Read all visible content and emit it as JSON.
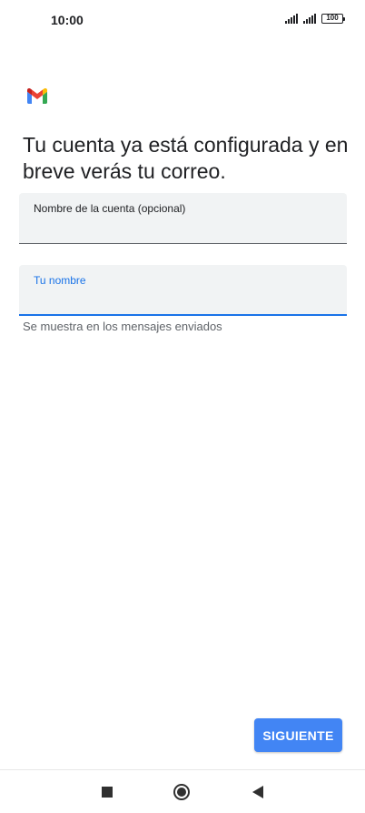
{
  "status_bar": {
    "time": "10:00",
    "battery": "100",
    "icons": [
      "signal-icon",
      "signal-icon",
      "battery-icon"
    ]
  },
  "app": {
    "logo": "gmail-logo",
    "brand_colors": {
      "blue": "#4285f4",
      "red": "#ea4335",
      "yellow": "#fbbc04",
      "green": "#34a853"
    }
  },
  "main": {
    "title": "Tu cuenta ya está configurada y en breve verás tu correo.",
    "account_name_field": {
      "label": "Nombre de la cuenta (opcional)",
      "value": ""
    },
    "your_name_field": {
      "label": "Tu nombre",
      "value": "",
      "focused": true
    },
    "helper_text": "Se muestra en los mensajes enviados"
  },
  "actions": {
    "next_label": "SIGUIENTE",
    "next_color": "#4285f4"
  },
  "nav_bar": {
    "buttons": [
      "recents-icon",
      "home-icon",
      "back-icon"
    ]
  }
}
